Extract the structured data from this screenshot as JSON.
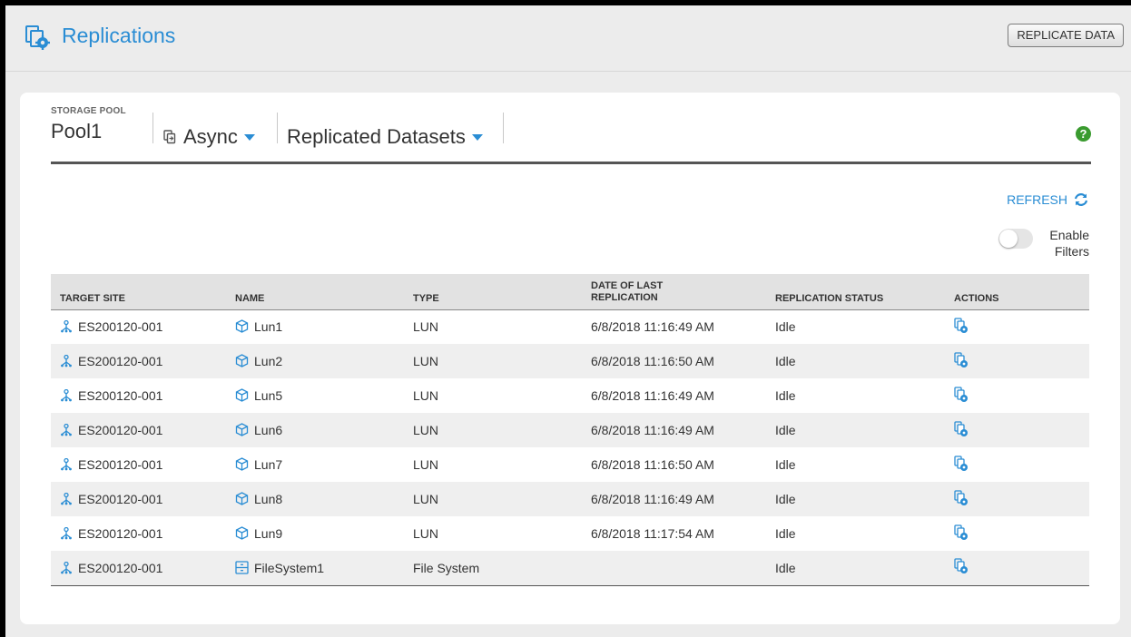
{
  "header": {
    "title": "Replications",
    "replicate_button": "REPLICATE DATA"
  },
  "toolbar": {
    "storage_pool_label": "STORAGE POOL",
    "storage_pool_value": "Pool1",
    "mode": "Async",
    "view": "Replicated Datasets"
  },
  "refresh_label": "REFRESH",
  "filters": {
    "label": "Enable Filters",
    "enabled": false
  },
  "table": {
    "columns": [
      "TARGET SITE",
      "NAME",
      "TYPE",
      "DATE OF LAST REPLICATION",
      "REPLICATION STATUS",
      "ACTIONS"
    ],
    "rows": [
      {
        "target_site": "ES200120-001",
        "name": "Lun1",
        "name_icon": "cube-icon",
        "type": "LUN",
        "date": "6/8/2018 11:16:49 AM",
        "status": "Idle"
      },
      {
        "target_site": "ES200120-001",
        "name": "Lun2",
        "name_icon": "cube-icon",
        "type": "LUN",
        "date": "6/8/2018 11:16:50 AM",
        "status": "Idle"
      },
      {
        "target_site": "ES200120-001",
        "name": "Lun5",
        "name_icon": "cube-icon",
        "type": "LUN",
        "date": "6/8/2018 11:16:49 AM",
        "status": "Idle"
      },
      {
        "target_site": "ES200120-001",
        "name": "Lun6",
        "name_icon": "cube-icon",
        "type": "LUN",
        "date": "6/8/2018 11:16:49 AM",
        "status": "Idle"
      },
      {
        "target_site": "ES200120-001",
        "name": "Lun7",
        "name_icon": "cube-icon",
        "type": "LUN",
        "date": "6/8/2018 11:16:50 AM",
        "status": "Idle"
      },
      {
        "target_site": "ES200120-001",
        "name": "Lun8",
        "name_icon": "cube-icon",
        "type": "LUN",
        "date": "6/8/2018 11:16:49 AM",
        "status": "Idle"
      },
      {
        "target_site": "ES200120-001",
        "name": "Lun9",
        "name_icon": "cube-icon",
        "type": "LUN",
        "date": "6/8/2018 11:17:54 AM",
        "status": "Idle"
      },
      {
        "target_site": "ES200120-001",
        "name": "FileSystem1",
        "name_icon": "filesystem-icon",
        "type": "File System",
        "date": "",
        "status": "Idle"
      }
    ]
  },
  "colors": {
    "accent": "#2a8dd4",
    "help": "#3a9b2f"
  }
}
